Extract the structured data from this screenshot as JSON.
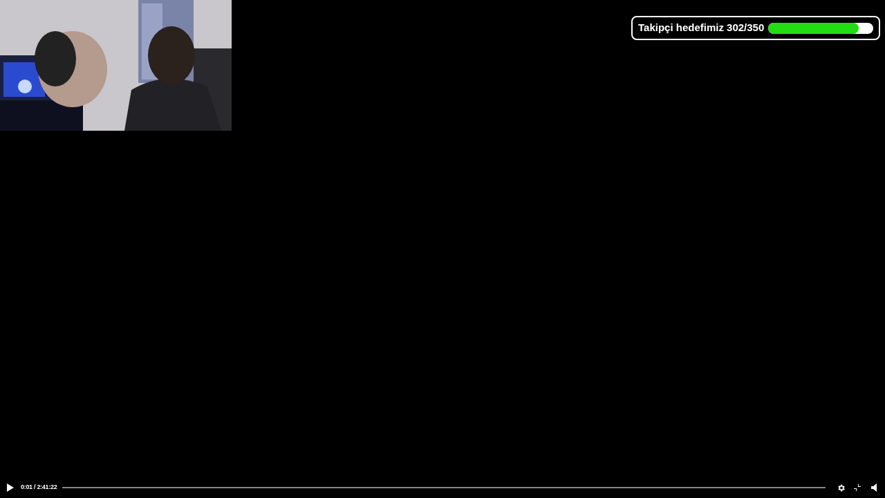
{
  "goal_overlay": {
    "label": "Takipçi hedefimiz 302/350",
    "level": 0.86
  },
  "controls": {
    "time": "0:01 / 2:41:22"
  }
}
